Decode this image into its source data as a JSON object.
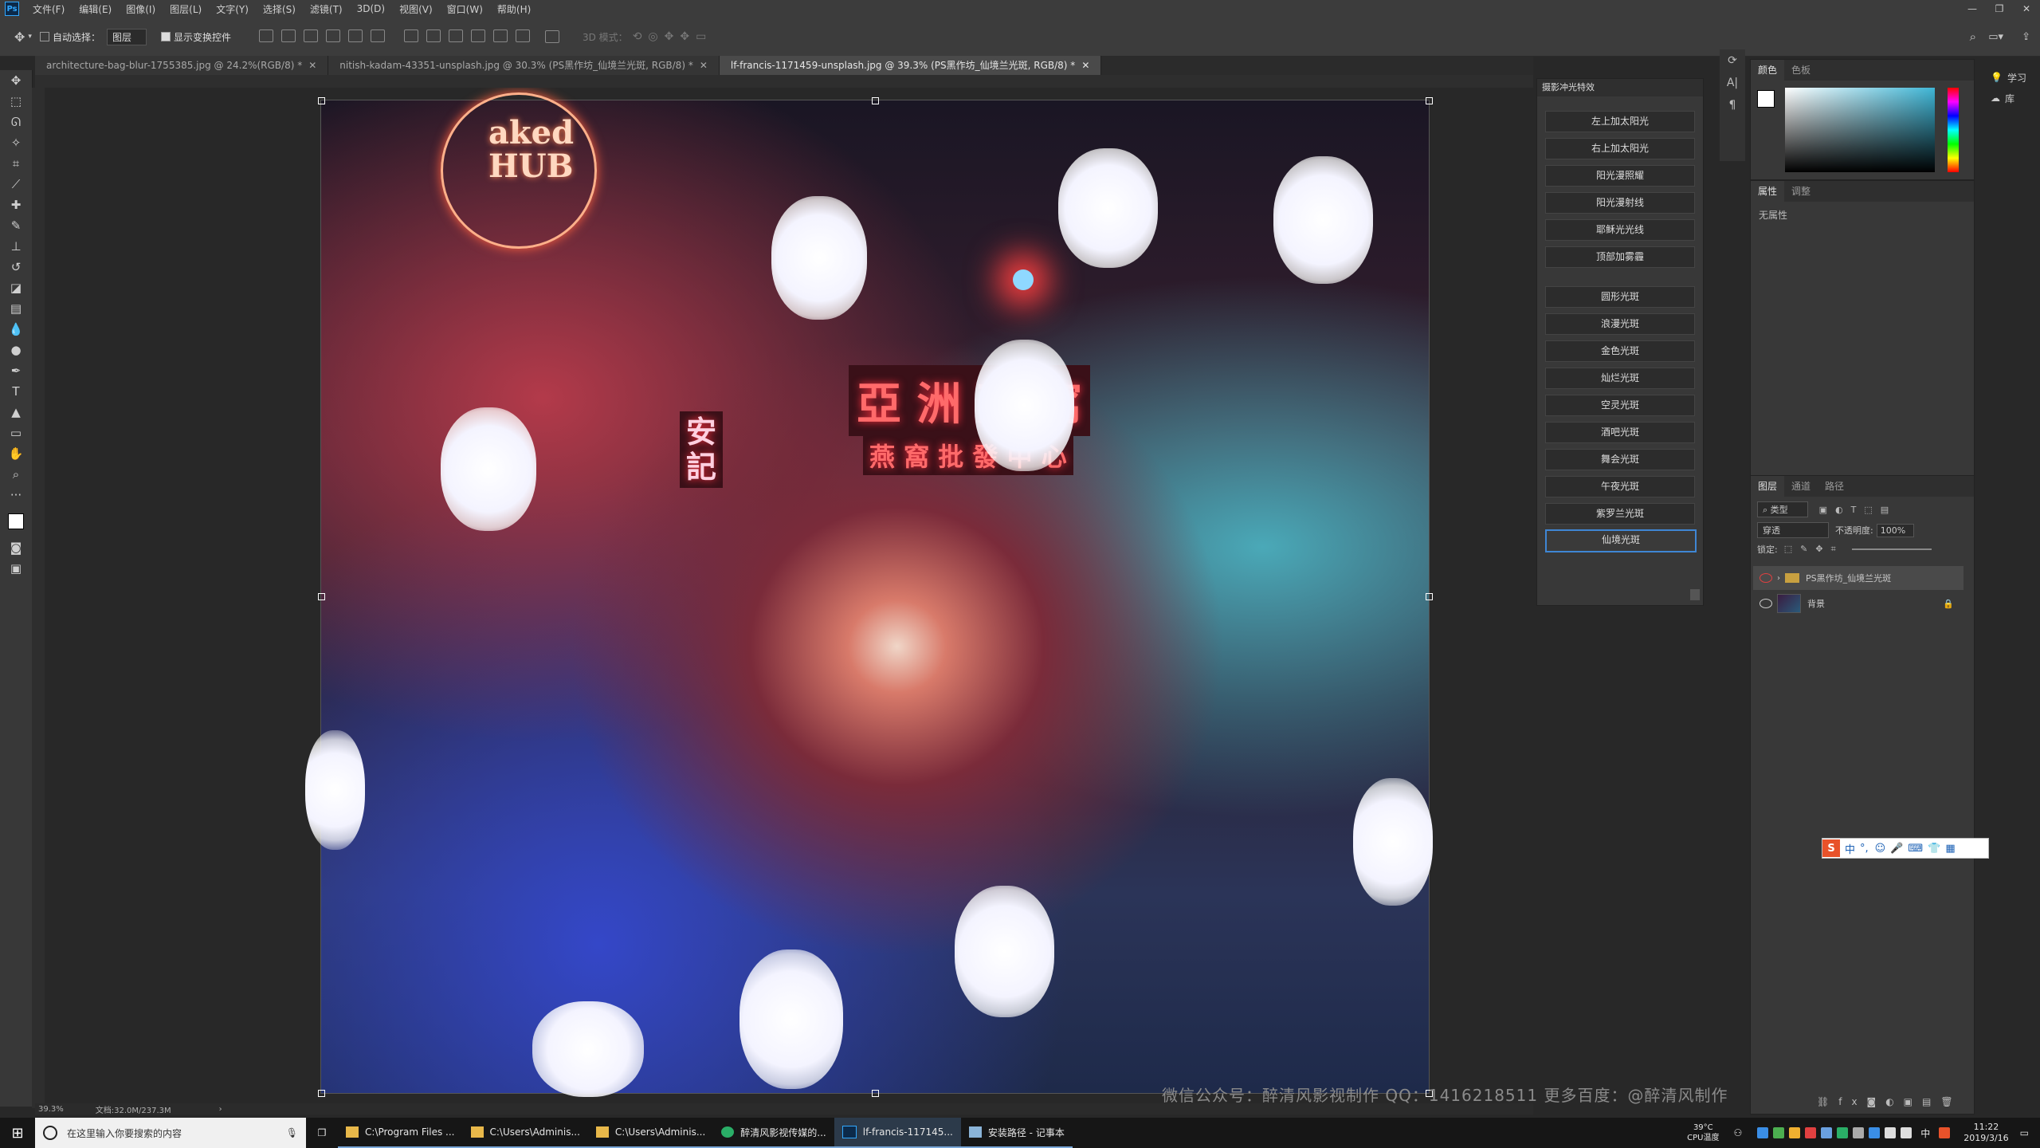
{
  "app": {
    "logo": "Ps"
  },
  "menu": [
    "文件(F)",
    "编辑(E)",
    "图像(I)",
    "图层(L)",
    "文字(Y)",
    "选择(S)",
    "滤镜(T)",
    "3D(D)",
    "视图(V)",
    "窗口(W)",
    "帮助(H)"
  ],
  "window_controls": [
    "—",
    "❐",
    "✕"
  ],
  "options": {
    "auto_select_label": "自动选择：",
    "auto_select_value": "图层",
    "show_transform_label": "显示变换控件",
    "mode_3d_label": "3D 模式："
  },
  "tabs": [
    {
      "label": "architecture-bag-blur-1755385.jpg @ 24.2%(RGB/8) *",
      "active": false
    },
    {
      "label": "nitish-kadam-43351-unsplash.jpg @ 30.3% (PS黑作坊_仙境兰光斑, RGB/8) *",
      "active": false
    },
    {
      "label": "lf-francis-1171459-unsplash.jpg @ 39.3% (PS黑作坊_仙境兰光斑, RGB/8) *",
      "active": true
    }
  ],
  "canvas": {
    "signs": {
      "club": "aked\nHUB",
      "big": "亞 洲 燕 窩",
      "sub": "燕 窩 批 發 中 心",
      "an": "安\n記"
    },
    "watermark": "微信公众号：醉清风影视制作    QQ：1416218511    更多百度：@醉清风制作"
  },
  "status": {
    "zoom": "39.3%",
    "doc": "文档:32.0M/237.3M"
  },
  "fx_panel": {
    "title": "摄影冲光特效",
    "buttons": [
      "左上加太阳光",
      "右上加太阳光",
      "阳光漫照耀",
      "阳光漫射线",
      "耶稣光光线",
      "顶部加雾霾",
      "圆形光斑",
      "浪漫光斑",
      "金色光斑",
      "灿烂光斑",
      "空灵光斑",
      "酒吧光斑",
      "舞会光斑",
      "午夜光斑",
      "紫罗兰光斑",
      "仙境光斑"
    ],
    "active": "仙境光斑"
  },
  "color_panel": {
    "tabs": [
      "颜色",
      "色板"
    ],
    "active": "颜色"
  },
  "props_panel": {
    "tabs": [
      "属性",
      "调整"
    ],
    "active": "属性",
    "empty_text": "无属性"
  },
  "layers_panel": {
    "tabs": [
      "图层",
      "通道",
      "路径"
    ],
    "active": "图层",
    "filter": "类型",
    "blend": "穿透",
    "opacity_label": "不透明度:",
    "opacity_value": "100%",
    "lock_label": "锁定:",
    "layers": [
      {
        "name": "PS黑作坊_仙境兰光斑",
        "type": "group",
        "selected": true
      },
      {
        "name": "背景",
        "type": "image",
        "locked": true
      }
    ]
  },
  "right_dock": {
    "learn": "学习",
    "libraries": "库"
  },
  "ime": {
    "logo": "S",
    "mode": "中",
    "punct": "°,"
  },
  "taskbar": {
    "search_placeholder": "在这里输入你要搜索的内容",
    "apps": [
      "C:\\Program Files ...",
      "C:\\Users\\Adminis...",
      "C:\\Users\\Adminis...",
      "醉清风影视传媒的...",
      "lf-francis-117145...",
      "安装路径 - 记事本"
    ],
    "temp": "39°C",
    "temp_label": "CPU温度",
    "ime_tray": "中",
    "time": "11:22",
    "date": "2019/3/16"
  }
}
